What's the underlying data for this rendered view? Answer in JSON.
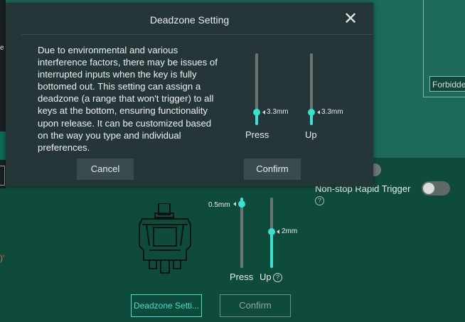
{
  "background": {
    "side_glyph": "e",
    "warning_fragment": ")'",
    "forbidden_input_value": "Forbidden",
    "rapid_trigger_label": "Non-stop Rapid Trigger",
    "press_slider": {
      "value": "0.5mm"
    },
    "up_slider": {
      "value": "2mm"
    },
    "press_label": "Press",
    "up_label": "Up",
    "help_glyph": "?",
    "deadzone_button_label": "Deadzone Setti...",
    "confirm_button_label": "Confirm"
  },
  "modal": {
    "title": "Deadzone Setting",
    "close_glyph": "✕",
    "description": "Due to environmental and various interference factors, there may be issues of interrupted inputs when the key is fully bottomed out. This setting can assign a deadzone (a range that won't trigger) to all keys at the bottom, ensuring functionality upon release. It can be customized based on the way you type and individual preferences.",
    "press_slider": {
      "value": "3.3mm"
    },
    "up_slider": {
      "value": "3.3mm"
    },
    "press_label": "Press",
    "up_label": "Up",
    "cancel_label": "Cancel",
    "confirm_label": "Confirm"
  },
  "colors": {
    "accent": "#3fe0cc",
    "modal_bg": "#253638",
    "page_bg": "#0f4b3b"
  }
}
